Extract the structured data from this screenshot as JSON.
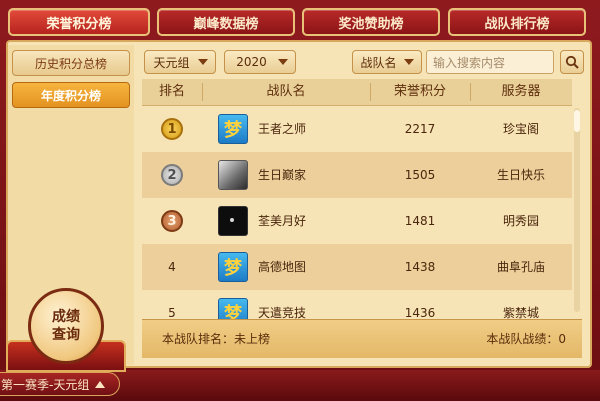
{
  "tabs": [
    {
      "label": "荣誉积分榜",
      "active": true
    },
    {
      "label": "巅峰数据榜",
      "active": false
    },
    {
      "label": "奖池赞助榜",
      "active": false
    },
    {
      "label": "战队排行榜",
      "active": false
    }
  ],
  "sidebar": {
    "items": [
      {
        "label": "历史积分总榜",
        "active": false
      },
      {
        "label": "年度积分榜",
        "active": true
      }
    ]
  },
  "filters": {
    "group": "天元组",
    "year": "2020",
    "search_type": "战队名",
    "search_placeholder": "输入搜索内容"
  },
  "table": {
    "headers": [
      "排名",
      "战队名",
      "荣誉积分",
      "服务器"
    ],
    "rows": [
      {
        "rank": "1",
        "name": "王者之师",
        "score": "2217",
        "server": "珍宝阁",
        "avatar": "dream-logo"
      },
      {
        "rank": "2",
        "name": "生日巅家",
        "score": "1505",
        "server": "生日快乐",
        "avatar": "photo"
      },
      {
        "rank": "3",
        "name": "荃美月好",
        "score": "1481",
        "server": "明秀园",
        "avatar": "night"
      },
      {
        "rank": "4",
        "name": "高德地图",
        "score": "1438",
        "server": "曲阜孔庙",
        "avatar": "dream-logo"
      },
      {
        "rank": "5",
        "name": "天遣竞技",
        "score": "1436",
        "server": "紫禁城",
        "avatar": "dream-logo"
      }
    ]
  },
  "footer": {
    "my_rank_label": "本战队排名：未上榜",
    "my_record_label": "本战队战绩：0"
  },
  "score_button": {
    "line1": "成绩",
    "line2": "查询"
  },
  "season_selector": "第一赛季-天元组",
  "logo_glyph": "梦"
}
